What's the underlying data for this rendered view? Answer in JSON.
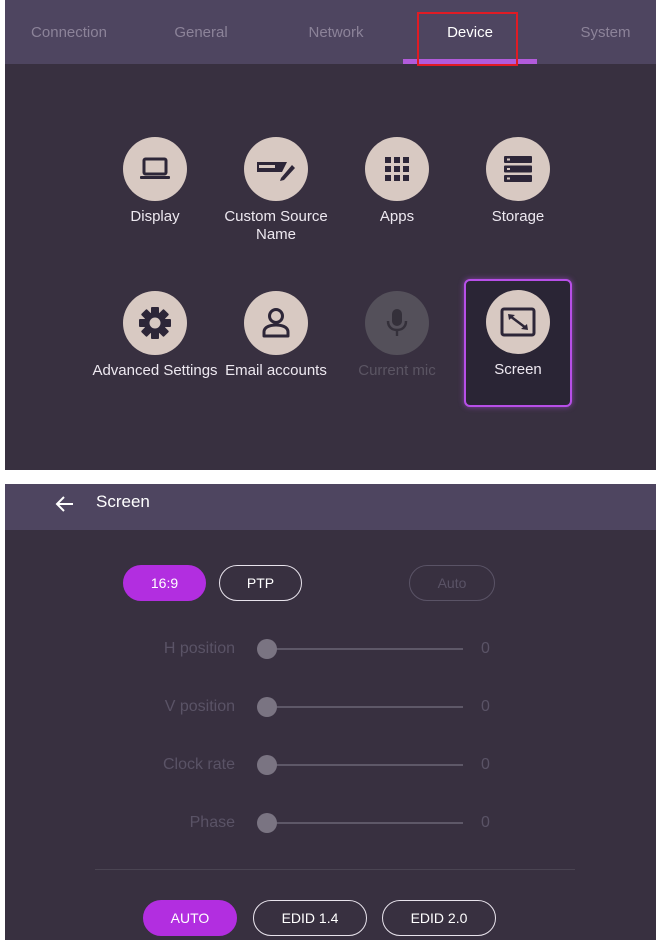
{
  "top_panel": {
    "tabs": [
      {
        "label": "Connection",
        "active": false
      },
      {
        "label": "General",
        "active": false
      },
      {
        "label": "Network",
        "active": false
      },
      {
        "label": "Device",
        "active": true
      },
      {
        "label": "System",
        "active": false
      }
    ],
    "tiles": [
      {
        "label": "Display",
        "icon": "laptop-icon",
        "state": "normal"
      },
      {
        "label": "Custom Source Name",
        "icon": "rename-icon",
        "state": "normal"
      },
      {
        "label": "Apps",
        "icon": "apps-grid-icon",
        "state": "normal"
      },
      {
        "label": "Storage",
        "icon": "storage-icon",
        "state": "normal"
      },
      {
        "label": "Advanced Settings",
        "icon": "gear-icon",
        "state": "normal"
      },
      {
        "label": "Email accounts",
        "icon": "user-icon",
        "state": "normal"
      },
      {
        "label": "Current mic",
        "icon": "microphone-icon",
        "state": "disabled"
      },
      {
        "label": "Screen",
        "icon": "screen-resize-icon",
        "state": "selected"
      }
    ]
  },
  "screen_panel": {
    "title": "Screen",
    "aspect_buttons": [
      {
        "label": "16:9",
        "state": "selected"
      },
      {
        "label": "PTP",
        "state": "normal"
      },
      {
        "label": "Auto",
        "state": "disabled"
      }
    ],
    "sliders": [
      {
        "label": "H position",
        "value": "0"
      },
      {
        "label": "V position",
        "value": "0"
      },
      {
        "label": "Clock rate",
        "value": "0"
      },
      {
        "label": "Phase",
        "value": "0"
      }
    ],
    "edid_buttons": [
      {
        "label": "AUTO",
        "state": "selected"
      },
      {
        "label": "EDID 1.4",
        "state": "normal"
      },
      {
        "label": "EDID 2.0",
        "state": "normal"
      }
    ]
  },
  "colors": {
    "background": "#383040",
    "header": "#4e4560",
    "accent": "#b22ee0",
    "highlight_box": "#e01b24",
    "icon_circle": "#d8c9c2"
  }
}
